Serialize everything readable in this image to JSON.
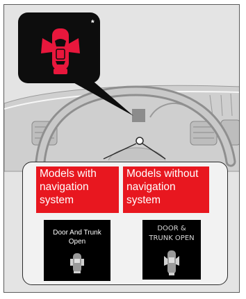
{
  "callout": {
    "icon": "door-open-car-icon",
    "icon_color": "#e8173c",
    "note_mark": "*"
  },
  "models": {
    "with_nav_label": "Models with navigation system",
    "without_nav_label": "Models without navigation system",
    "label_color": "#e8171f"
  },
  "displays": {
    "with_nav_text_line1": "Door And Trunk",
    "with_nav_text_line2": "Open",
    "without_nav_text_line1": "DOOR &",
    "without_nav_text_line2": "TRUNK OPEN"
  }
}
